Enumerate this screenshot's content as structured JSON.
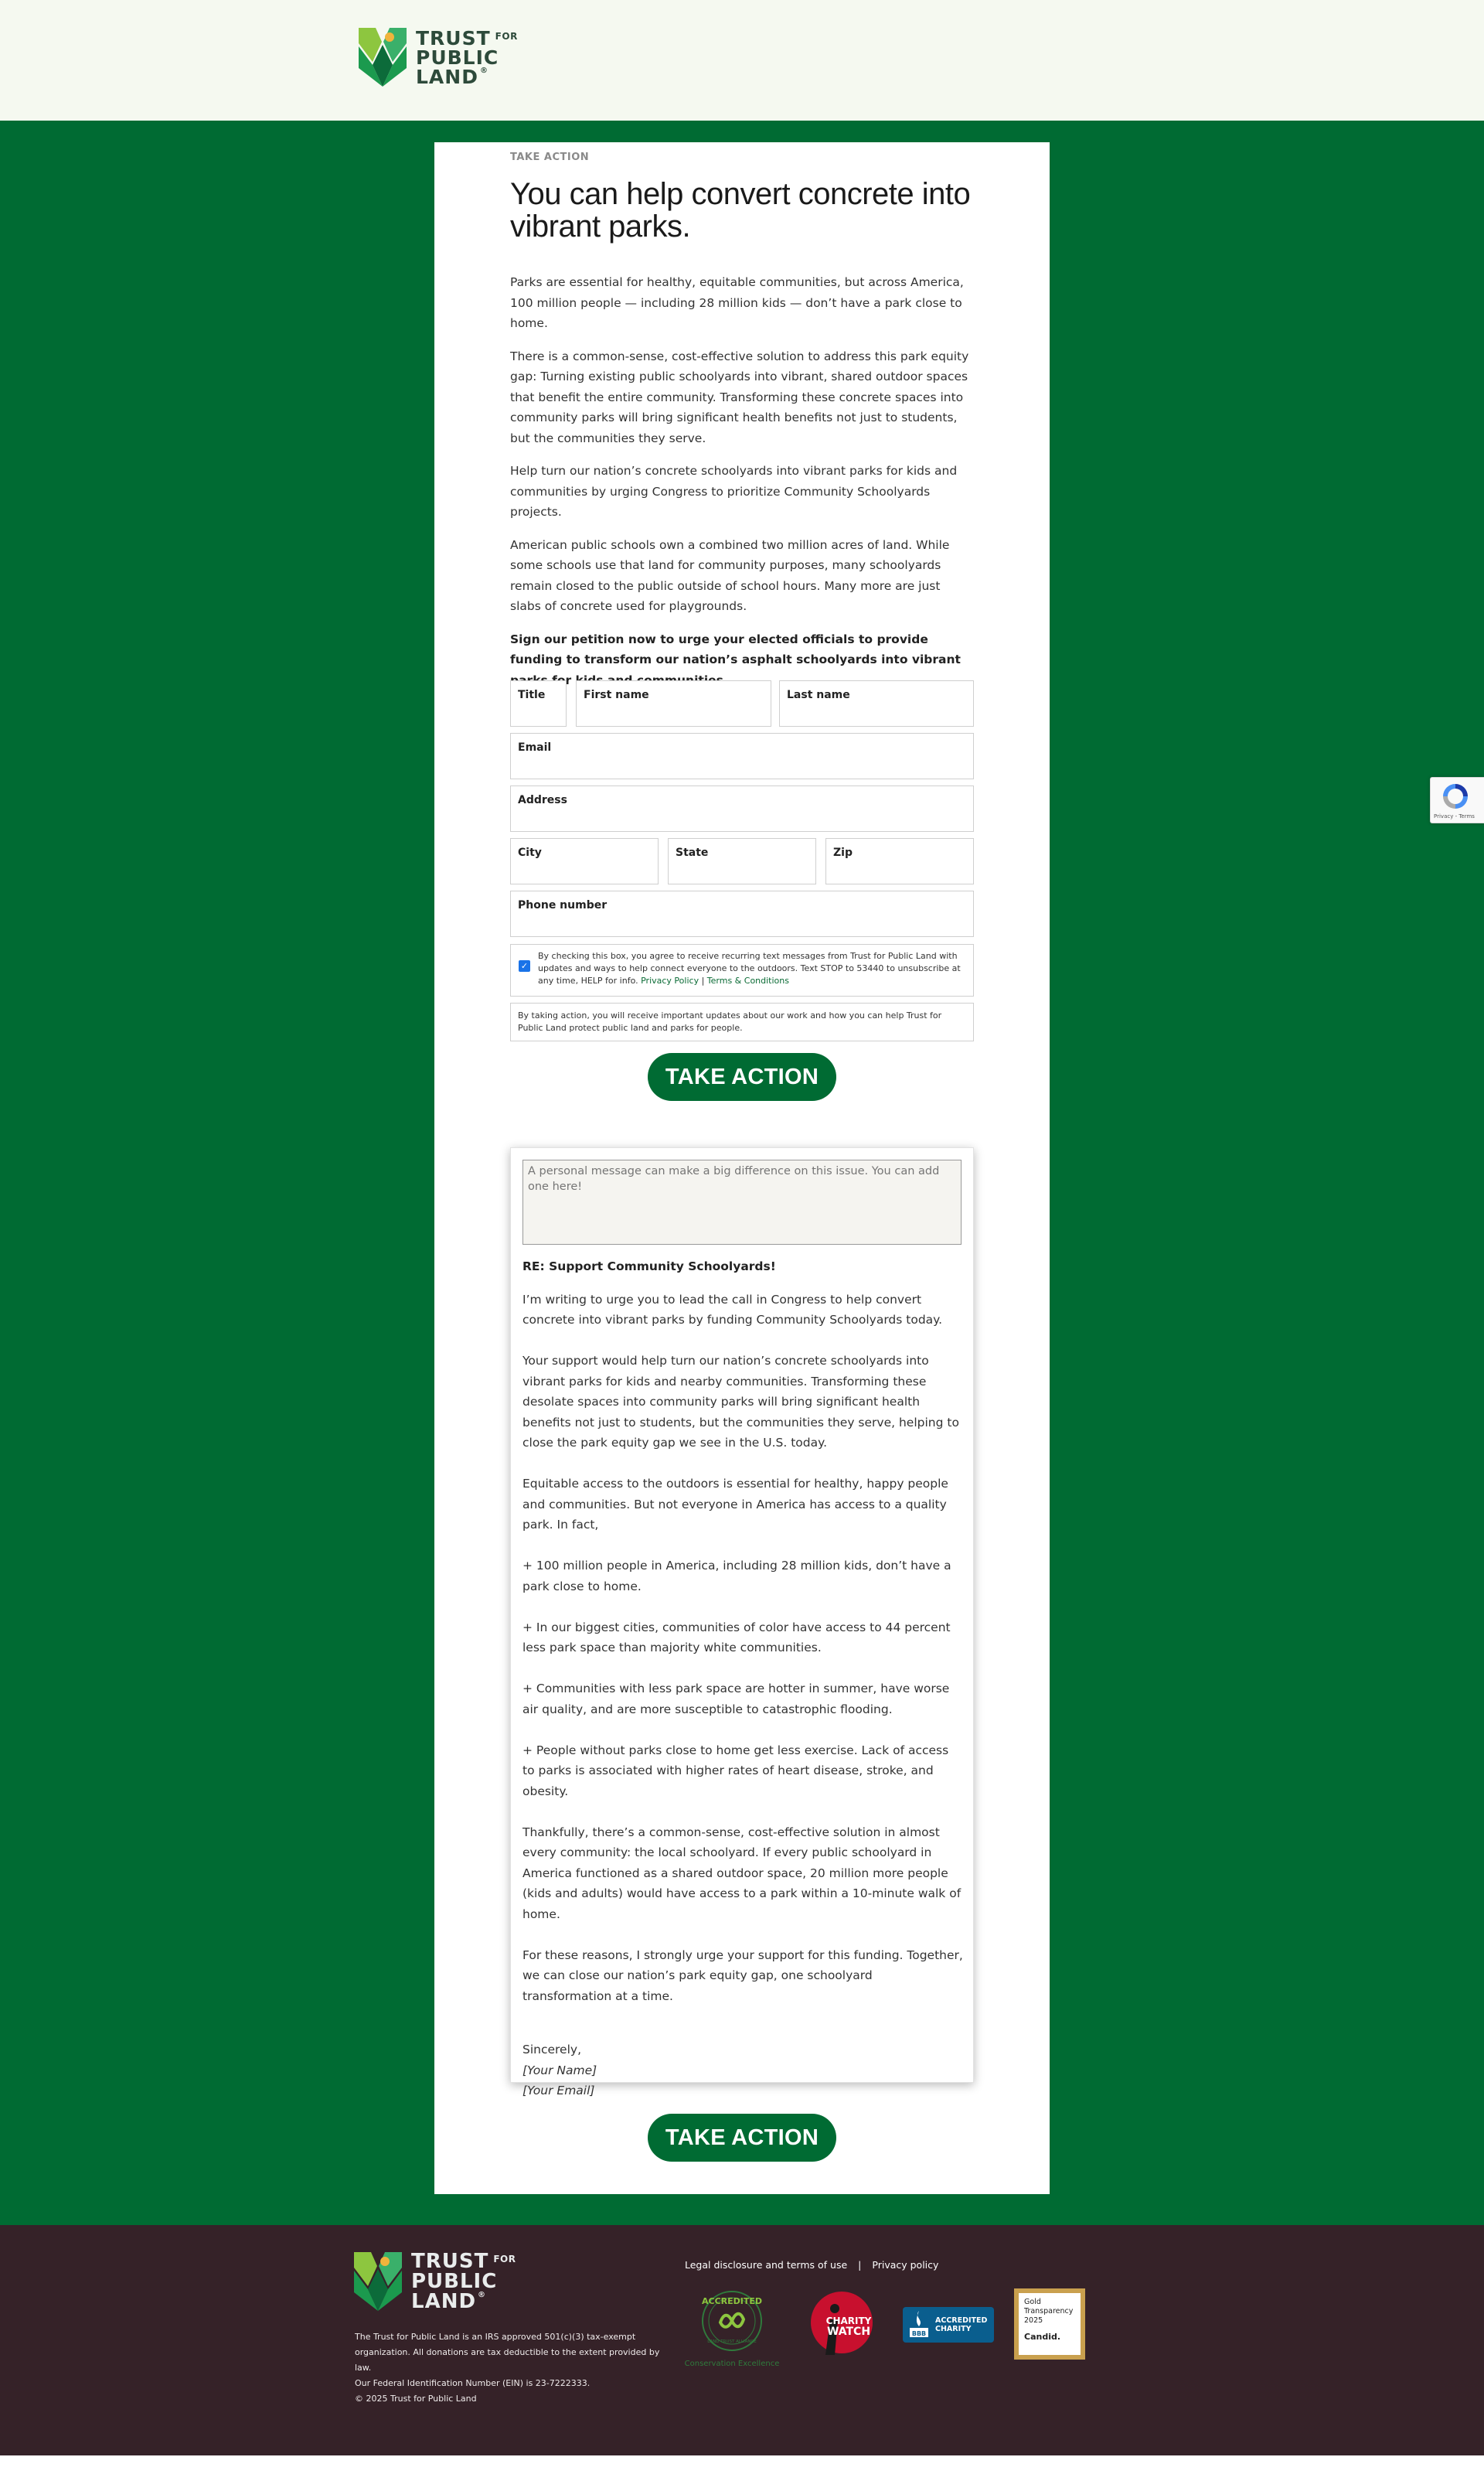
{
  "brand": {
    "line1": "TRUST",
    "for": "FOR",
    "line2": "PUBLIC",
    "line3": "LAND",
    "reg": "®",
    "green": "#006b33",
    "footer_bg": "#352228",
    "header_bg": "#f5f9f0"
  },
  "main": {
    "eyebrow": "TAKE ACTION",
    "headline": "You can help convert concrete into vibrant parks.",
    "paragraphs": [
      "Parks are essential for healthy, equitable communities, but across America, 100 million people — including 28 million kids — don’t have a park close to home.",
      "There is a common-sense, cost-effective solution to address this park equity gap: Turning existing public schoolyards into vibrant, shared outdoor spaces that benefit the entire community. Transforming these concrete spaces into community parks will bring significant health benefits not just to students, but the communities they serve.",
      "Help turn our nation’s concrete schoolyards into vibrant parks for kids and communities by urging Congress to prioritize Community Schoolyards projects.",
      "American public schools own a combined two million acres of land. While some schools use that land for community purposes, many schoolyards remain closed to the public outside of school hours. Many more are just slabs of concrete used for playgrounds."
    ],
    "call": "Sign our petition now to urge your elected officials to provide funding to transform our nation’s asphalt schoolyards into vibrant parks for kids and communities."
  },
  "form": {
    "title_label": "Title",
    "first_name_label": "First name",
    "last_name_label": "Last name",
    "email_label": "Email",
    "address_label": "Address",
    "city_label": "City",
    "state_label": "State",
    "zip_label": "Zip",
    "phone_label": "Phone number",
    "sms_checked": true,
    "sms_text": "By checking this box, you agree to receive recurring text messages from Trust for Public Land with updates and ways to help connect everyone to the outdoors. Text STOP to 53440 to unsubscribe at any time, HELP for info.",
    "privacy_link": "Privacy Policy",
    "separator": "|",
    "terms_link": "Terms & Conditions",
    "notice": "By taking action, you will receive important updates about our work and how you can help Trust for Public Land protect public land and parks for people.",
    "submit_label": "TAKE ACTION"
  },
  "letter": {
    "personal_placeholder": "A personal message can make a big difference on this issue. You can add one here!",
    "subject": "RE: Support Community Schoolyards!",
    "paragraphs": [
      "I’m writing to urge you to lead the call in Congress to help convert concrete into vibrant parks by funding Community Schoolyards today.",
      "Your support would help turn our nation’s concrete schoolyards into vibrant parks for kids and nearby communities. Transforming these desolate spaces into community parks will bring significant health benefits not just to students, but the communities they serve, helping to close the park equity gap we see in the U.S. today.",
      "Equitable access to the outdoors is essential for healthy, happy people and communities. But not everyone in America has access to a quality park. In fact,",
      "+ 100 million people in America, including 28 million kids, don’t have a park close to home.",
      "+ In our biggest cities, communities of color have access to 44 percent less park space than majority white communities.",
      "+ Communities with less park space are hotter in summer, have worse air quality, and are more susceptible to catastrophic flooding.",
      "+ People without parks close to home get less exercise. Lack of access to parks is associated with higher rates of heart disease, stroke, and obesity.",
      "Thankfully, there’s a common-sense, cost-effective solution in almost every community: the local schoolyard. If every public schoolyard in America functioned as a shared outdoor space, 20 million more people (kids and adults) would have access to a park within a 10-minute walk of home.",
      "For these reasons, I strongly urge your support for this funding. Together, we can close our nation’s park equity gap, one schoolyard transformation at a time."
    ],
    "closing": "Sincerely,",
    "name_placeholder": "[Your Name]",
    "email_placeholder": "[Your Email]"
  },
  "recaptcha": {
    "text": "Privacy - Terms",
    "icon": "recaptcha-icon"
  },
  "footer": {
    "legal": [
      "The Trust for Public Land is an IRS approved 501(c)(3) tax-exempt",
      "organization. All donations are tax deductible to the extent provided by law.",
      "Our Federal Identification Number (EIN) is 23-7222333.",
      "© 2025 Trust for Public Land"
    ],
    "links": {
      "legal": "Legal disclosure and terms of use",
      "separator": "|",
      "privacy": "Privacy policy"
    },
    "badges": {
      "accredited_top": "ACCREDITED",
      "accredited_ring": "LAND TRUST ALLIANCE",
      "accredited_caption": "Conservation Excellence",
      "charity_line1": "CHARITY",
      "charity_line2": "WATCH",
      "bbb_mark": "BBB",
      "bbb_line1": "ACCREDITED",
      "bbb_line2": "CHARITY",
      "candid_line1": "Gold",
      "candid_line2": "Transparency",
      "candid_line3": "2025",
      "candid_brand": "Candid."
    }
  }
}
